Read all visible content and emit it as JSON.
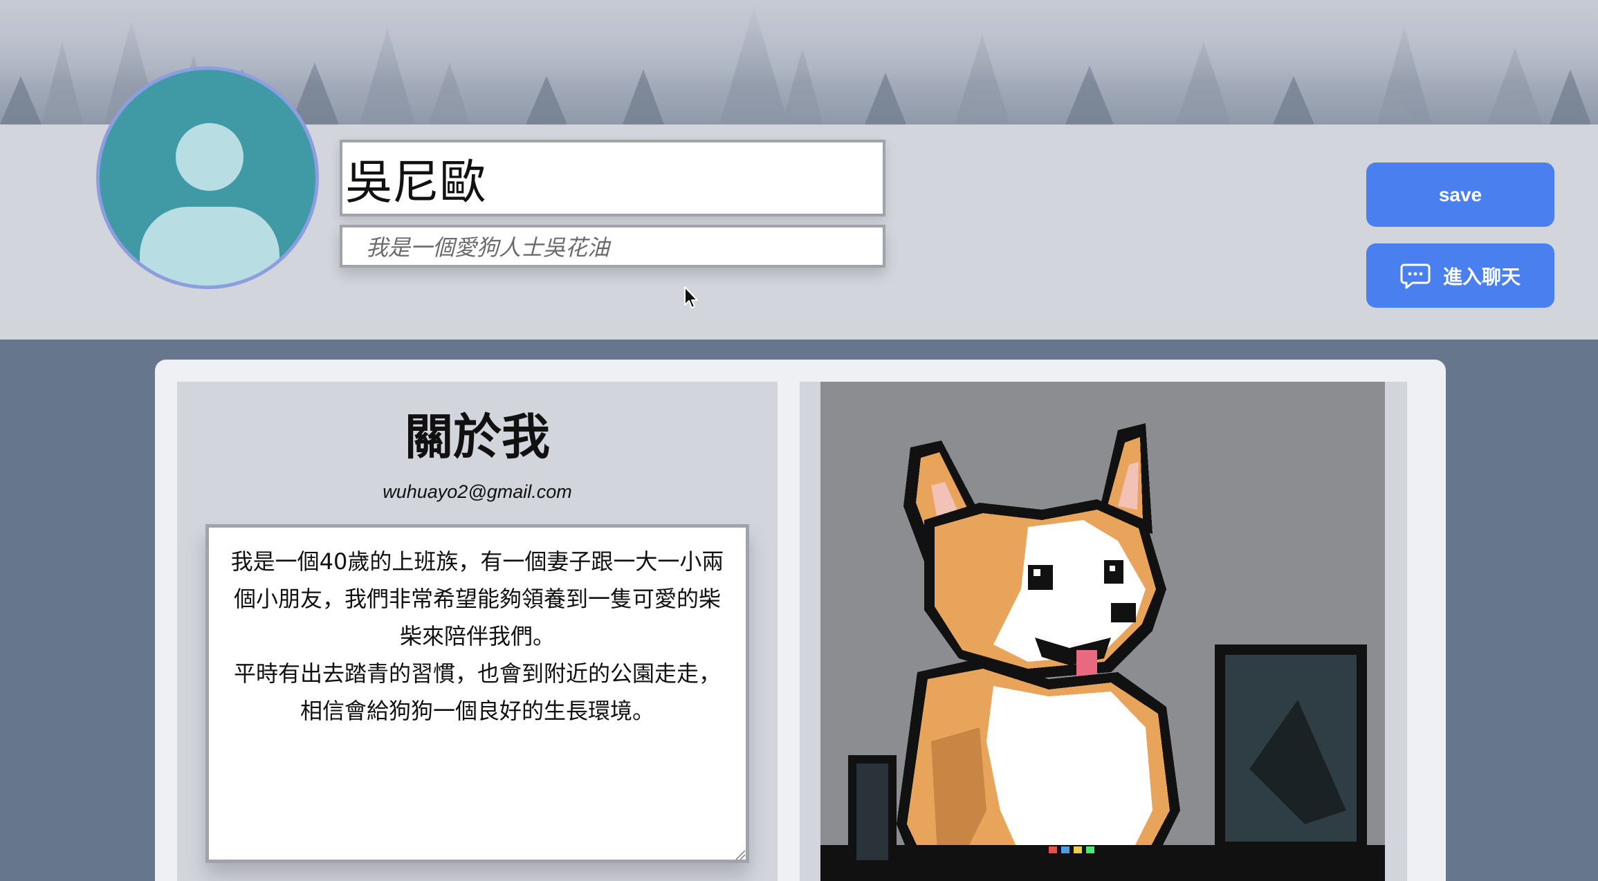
{
  "profile": {
    "name": "吳尼歐",
    "bio": "我是一個愛狗人士吳花油",
    "avatar_icon": "user-silhouette-icon"
  },
  "actions": {
    "save_label": "save",
    "chat_label": "進入聊天",
    "chat_icon": "chat-bubble-icon"
  },
  "about": {
    "title": "關於我",
    "email": "wuhuayo2@gmail.com",
    "description": "我是一個40歲的上班族，有一個妻子跟一大一小兩個小朋友，我們非常希望能夠領養到一隻可愛的柴柴來陪伴我們。\n平時有出去踏青的習慣，也會到附近的公園走走，相信會給狗狗一個良好的生長環境。"
  },
  "pet_image": {
    "subject": "pixel-art corgi dog at a computer"
  },
  "colors": {
    "accent": "#4a7ff0",
    "header_bg": "#d2d5dc",
    "page_bg": "#66768c",
    "avatar_bg": "#3f9aa6",
    "avatar_border": "#8d9ee0"
  }
}
